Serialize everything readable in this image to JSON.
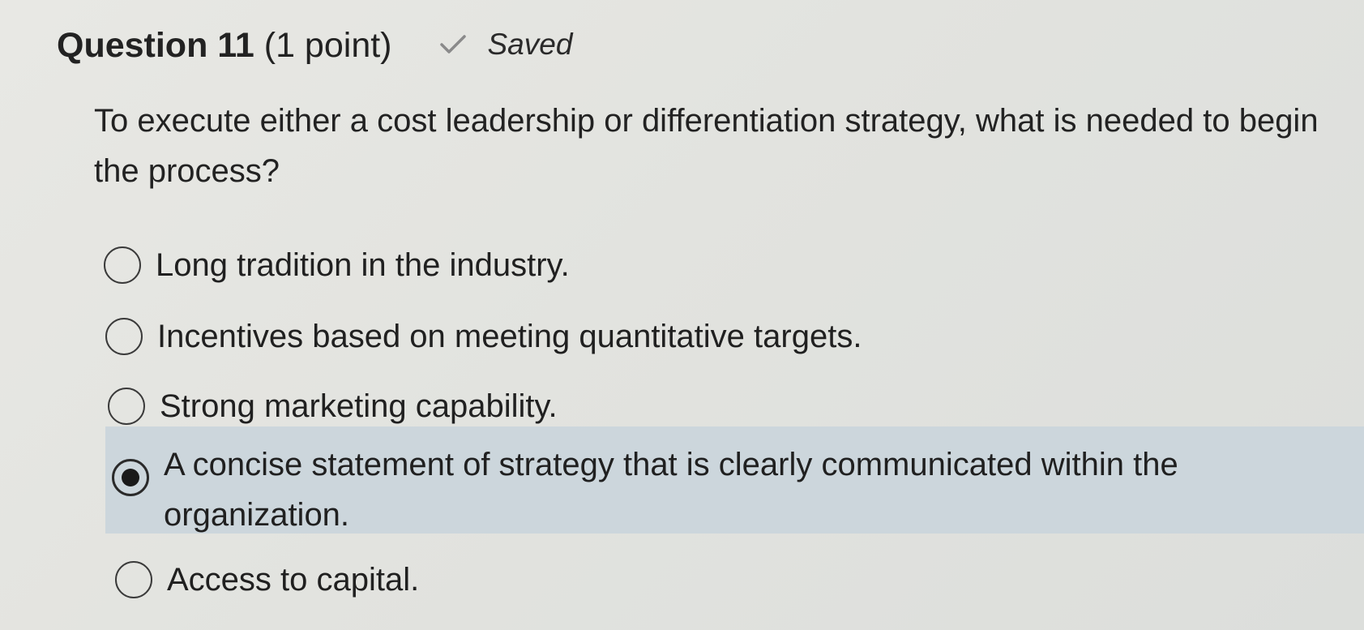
{
  "question": {
    "title": "Question 11",
    "points": "(1 point)",
    "status": "Saved",
    "status_icon": "checkmark-icon",
    "text": "To execute either a cost leadership or differentiation strategy, what is needed to begin the process?"
  },
  "options": [
    {
      "label": "Long tradition in the industry.",
      "selected": false
    },
    {
      "label": "Incentives based on meeting quantitative targets.",
      "selected": false
    },
    {
      "label": "Strong marketing capability.",
      "selected": false
    },
    {
      "label": "A concise statement of strategy that is clearly communicated within the organization.",
      "selected": true
    },
    {
      "label": "Access to capital.",
      "selected": false
    }
  ],
  "colors": {
    "selected_highlight": "#ccd6dc",
    "text": "#222222"
  }
}
